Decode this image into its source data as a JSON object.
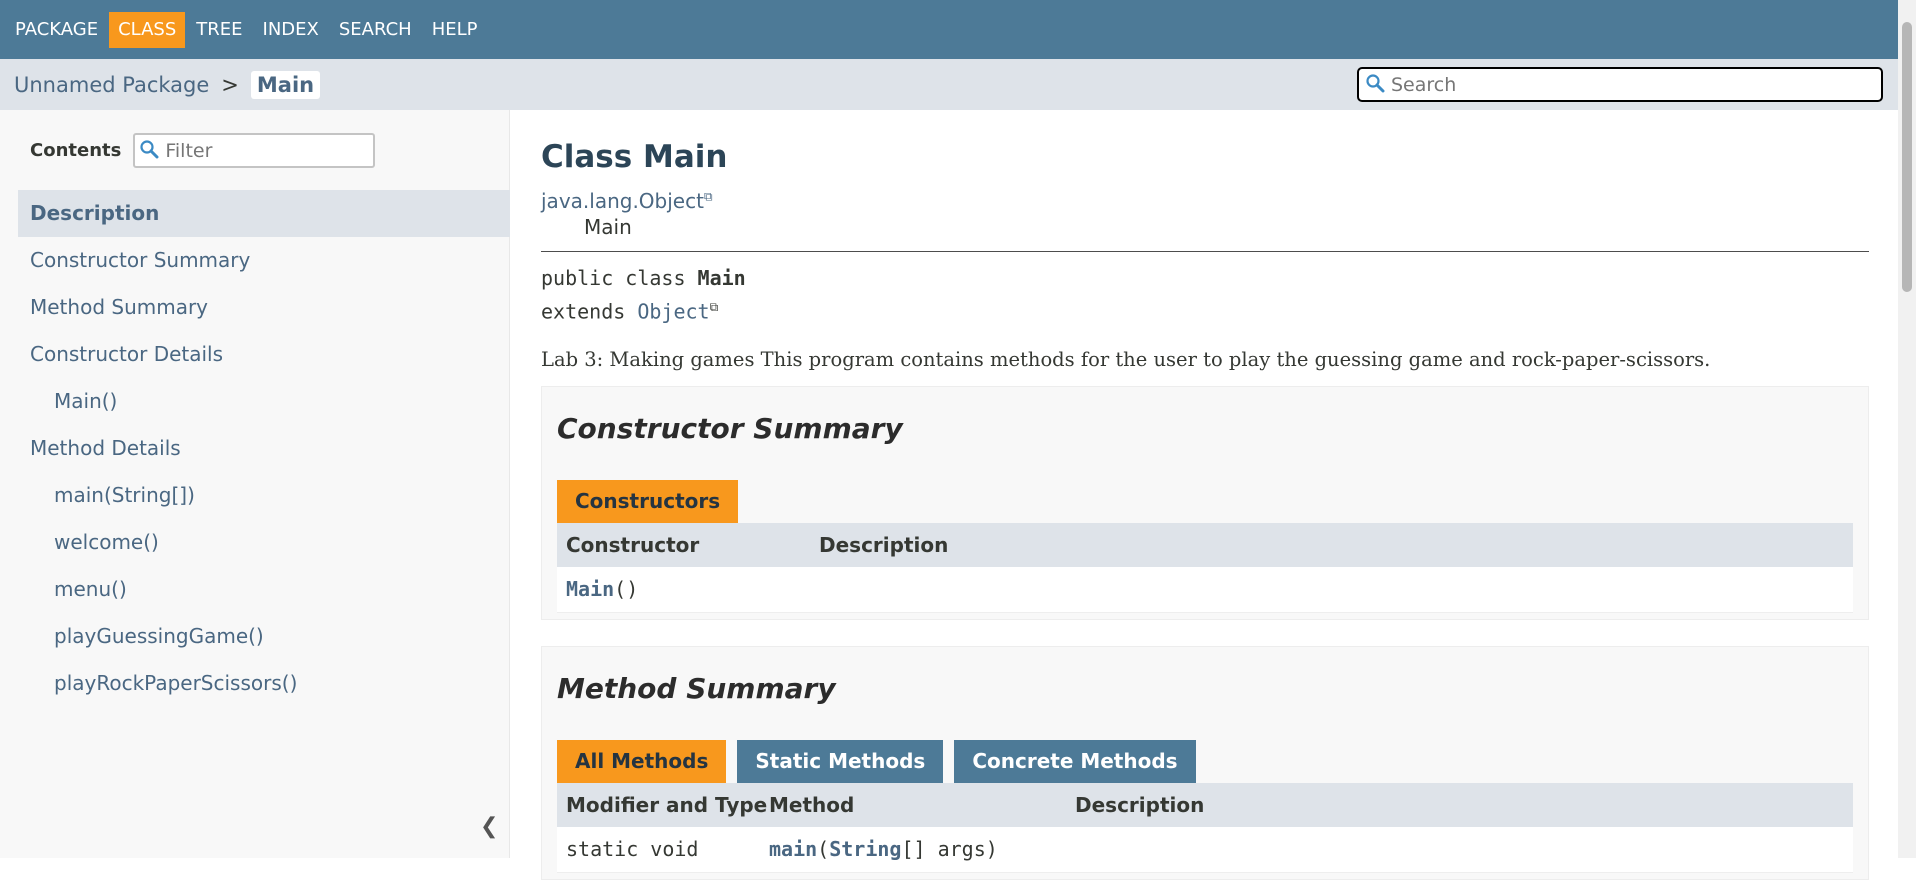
{
  "nav": {
    "items": [
      {
        "label": "PACKAGE",
        "active": false
      },
      {
        "label": "CLASS",
        "active": true
      },
      {
        "label": "TREE",
        "active": false
      },
      {
        "label": "INDEX",
        "active": false
      },
      {
        "label": "SEARCH",
        "active": false
      },
      {
        "label": "HELP",
        "active": false
      }
    ]
  },
  "breadcrumb": {
    "package": "Unnamed Package",
    "separator": ">",
    "current": "Main"
  },
  "search": {
    "placeholder": "Search",
    "icon": "search-icon"
  },
  "sidebar": {
    "contents_label": "Contents",
    "filter_placeholder": "Filter",
    "items": [
      {
        "label": "Description",
        "selected": true,
        "sub": false
      },
      {
        "label": "Constructor Summary",
        "selected": false,
        "sub": false
      },
      {
        "label": "Method Summary",
        "selected": false,
        "sub": false
      },
      {
        "label": "Constructor Details",
        "selected": false,
        "sub": false
      },
      {
        "label": "Main()",
        "selected": false,
        "sub": true
      },
      {
        "label": "Method Details",
        "selected": false,
        "sub": false
      },
      {
        "label": "main(String[])",
        "selected": false,
        "sub": true
      },
      {
        "label": "welcome()",
        "selected": false,
        "sub": true
      },
      {
        "label": "menu()",
        "selected": false,
        "sub": true
      },
      {
        "label": "playGuessingGame()",
        "selected": false,
        "sub": true
      },
      {
        "label": "playRockPaperScissors()",
        "selected": false,
        "sub": true
      }
    ],
    "collapse_glyph": "❮"
  },
  "main": {
    "title": "Class Main",
    "inheritance_parent": "java.lang.Object",
    "inheritance_child": "Main",
    "external_link_glyph": "⧉",
    "signature": {
      "line1_prefix": "public class ",
      "line1_name": "Main",
      "line2_prefix": "extends ",
      "line2_link": "Object"
    },
    "description": "Lab 3: Making games This program contains methods for the user to play the guessing game and rock-paper-scissors.",
    "constructor_summary": {
      "heading": "Constructor Summary",
      "tab": "Constructors",
      "col_constructor": "Constructor",
      "col_description": "Description",
      "row_link": "Main",
      "row_suffix": "()"
    },
    "method_summary": {
      "heading": "Method Summary",
      "tabs": [
        "All Methods",
        "Static Methods",
        "Concrete Methods"
      ],
      "col_modifier": "Modifier and Type",
      "col_method": "Method",
      "col_description": "Description",
      "row_modifier": "static void",
      "row_method_link": "main",
      "row_method_open": "(",
      "row_param_link": "String",
      "row_param_suffix": "[] args)"
    }
  },
  "colors": {
    "nav_bg": "#4d7a97",
    "accent": "#f8981d",
    "subnav_bg": "#dee3e9",
    "link": "#4a6782"
  }
}
